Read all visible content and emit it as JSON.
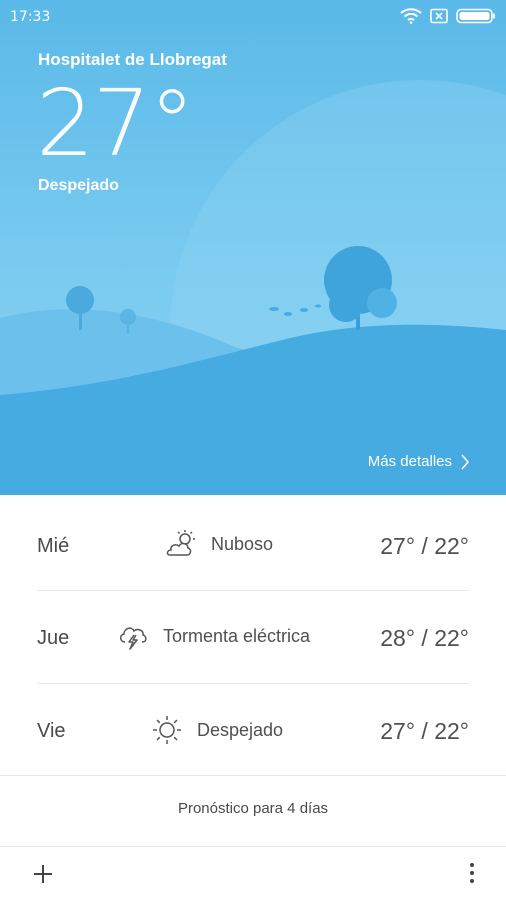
{
  "status_bar": {
    "time": "17:33",
    "icons": [
      "wifi-icon",
      "no-sim-icon",
      "battery-icon"
    ]
  },
  "current": {
    "city": "Hospitalet de Llobregat",
    "temperature": "27°",
    "condition": "Despejado",
    "more_details_label": "Más detalles"
  },
  "forecast": [
    {
      "day": "Mié",
      "icon": "partly-cloudy-icon",
      "condition": "Nuboso",
      "range": "27° / 22°"
    },
    {
      "day": "Jue",
      "icon": "thunderstorm-icon",
      "condition": "Tormenta eléctrica",
      "range": "28° / 22°"
    },
    {
      "day": "Vie",
      "icon": "sun-icon",
      "condition": "Despejado",
      "range": "27° / 22°"
    }
  ],
  "forecast_link_label": "Pronóstico para 4 días",
  "bottom_bar": {
    "add_icon": "plus-icon",
    "menu_icon": "more-vertical-icon"
  },
  "colors": {
    "hero_top": "#5bbdea",
    "hero_bottom": "#8fd3f2",
    "hill_far": "#6cc3ee",
    "hill_near": "#3ea9df",
    "text_dark": "#4a4a4a"
  }
}
